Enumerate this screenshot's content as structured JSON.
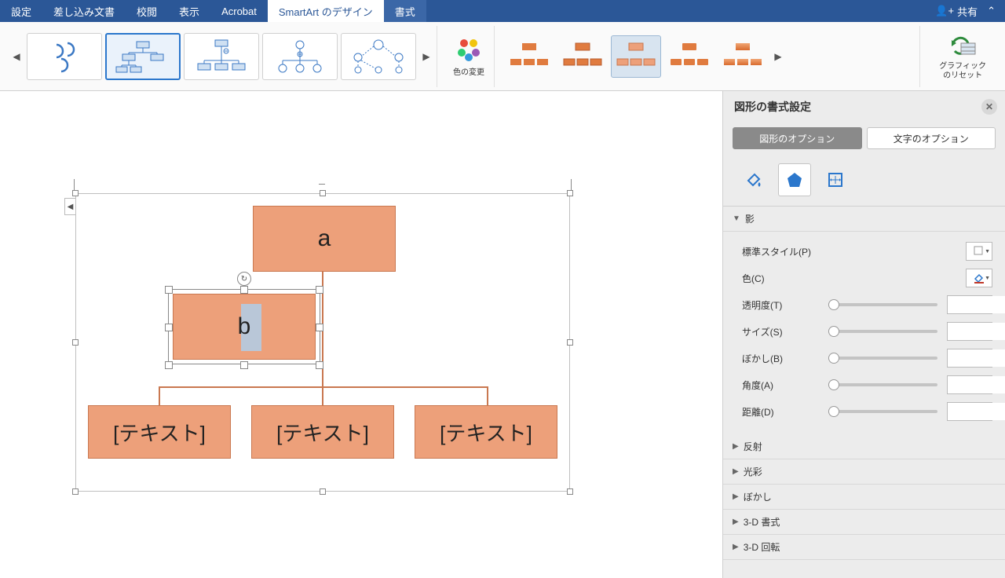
{
  "menubar": {
    "items": [
      "設定",
      "差し込み文書",
      "校閲",
      "表示",
      "Acrobat",
      "SmartArt のデザイン",
      "書式"
    ],
    "active_index": 5,
    "share_label": "共有"
  },
  "ribbon": {
    "color_change_label": "色の変更",
    "reset_label_line1": "グラフィック",
    "reset_label_line2": "のリセット"
  },
  "canvas": {
    "box_a": "a",
    "box_b": "b",
    "placeholder": "[テキスト]"
  },
  "panel": {
    "title": "図形の書式設定",
    "tab_shape": "図形のオプション",
    "tab_text": "文字のオプション",
    "sections": {
      "shadow": "影",
      "reflection": "反射",
      "glow": "光彩",
      "soft_edges": "ぼかし",
      "format_3d": "3-D 書式",
      "rotation_3d": "3-D 回転"
    },
    "props": {
      "preset": "標準スタイル(P)",
      "color": "色(C)",
      "transparency": "透明度(T)",
      "size": "サイズ(S)",
      "blur": "ぼかし(B)",
      "angle": "角度(A)",
      "distance": "距離(D)"
    }
  }
}
